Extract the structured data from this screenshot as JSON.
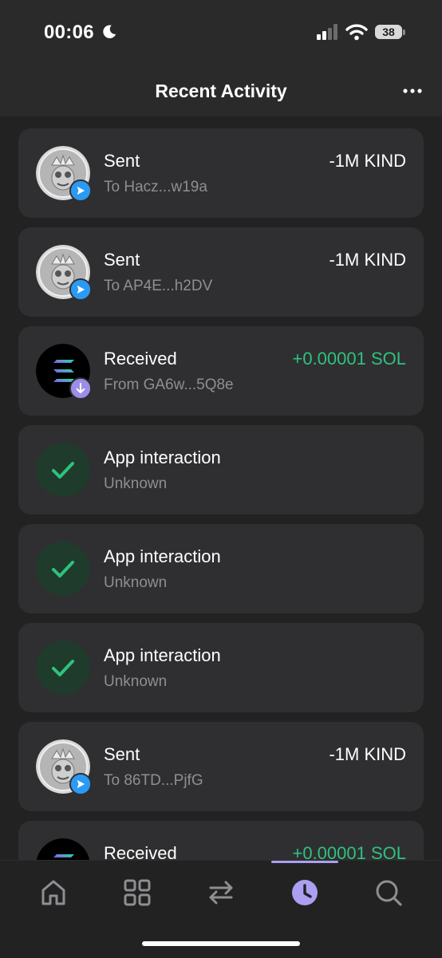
{
  "status_bar": {
    "time": "00:06",
    "battery": "38",
    "icons": [
      "moon-icon",
      "signal-icon",
      "wifi-icon",
      "battery-icon"
    ]
  },
  "header": {
    "title": "Recent Activity",
    "more_icon": "ellipsis-icon"
  },
  "activity": [
    {
      "type": "sent",
      "title": "Sent",
      "subtitle": "To Hacz...w19a",
      "amount": "-1M KIND",
      "amount_color": "#ffffff"
    },
    {
      "type": "sent",
      "title": "Sent",
      "subtitle": "To AP4E...h2DV",
      "amount": "-1M KIND",
      "amount_color": "#ffffff"
    },
    {
      "type": "received",
      "title": "Received",
      "subtitle": "From GA6w...5Q8e",
      "amount": "+0.00001 SOL",
      "amount_color": "#2ec27e"
    },
    {
      "type": "app",
      "title": "App interaction",
      "subtitle": "Unknown",
      "amount": ""
    },
    {
      "type": "app",
      "title": "App interaction",
      "subtitle": "Unknown",
      "amount": ""
    },
    {
      "type": "app",
      "title": "App interaction",
      "subtitle": "Unknown",
      "amount": ""
    },
    {
      "type": "sent",
      "title": "Sent",
      "subtitle": "To 86TD...PjfG",
      "amount": "-1M KIND",
      "amount_color": "#ffffff"
    },
    {
      "type": "received",
      "title": "Received",
      "subtitle": "",
      "amount": "+0.00001 SOL",
      "amount_color": "#2ec27e"
    }
  ],
  "tab_bar": {
    "tabs": [
      "home-icon",
      "grid-icon",
      "swap-icon",
      "history-icon",
      "search-icon"
    ],
    "active": "history-icon",
    "accent": "#ab9ff2"
  }
}
